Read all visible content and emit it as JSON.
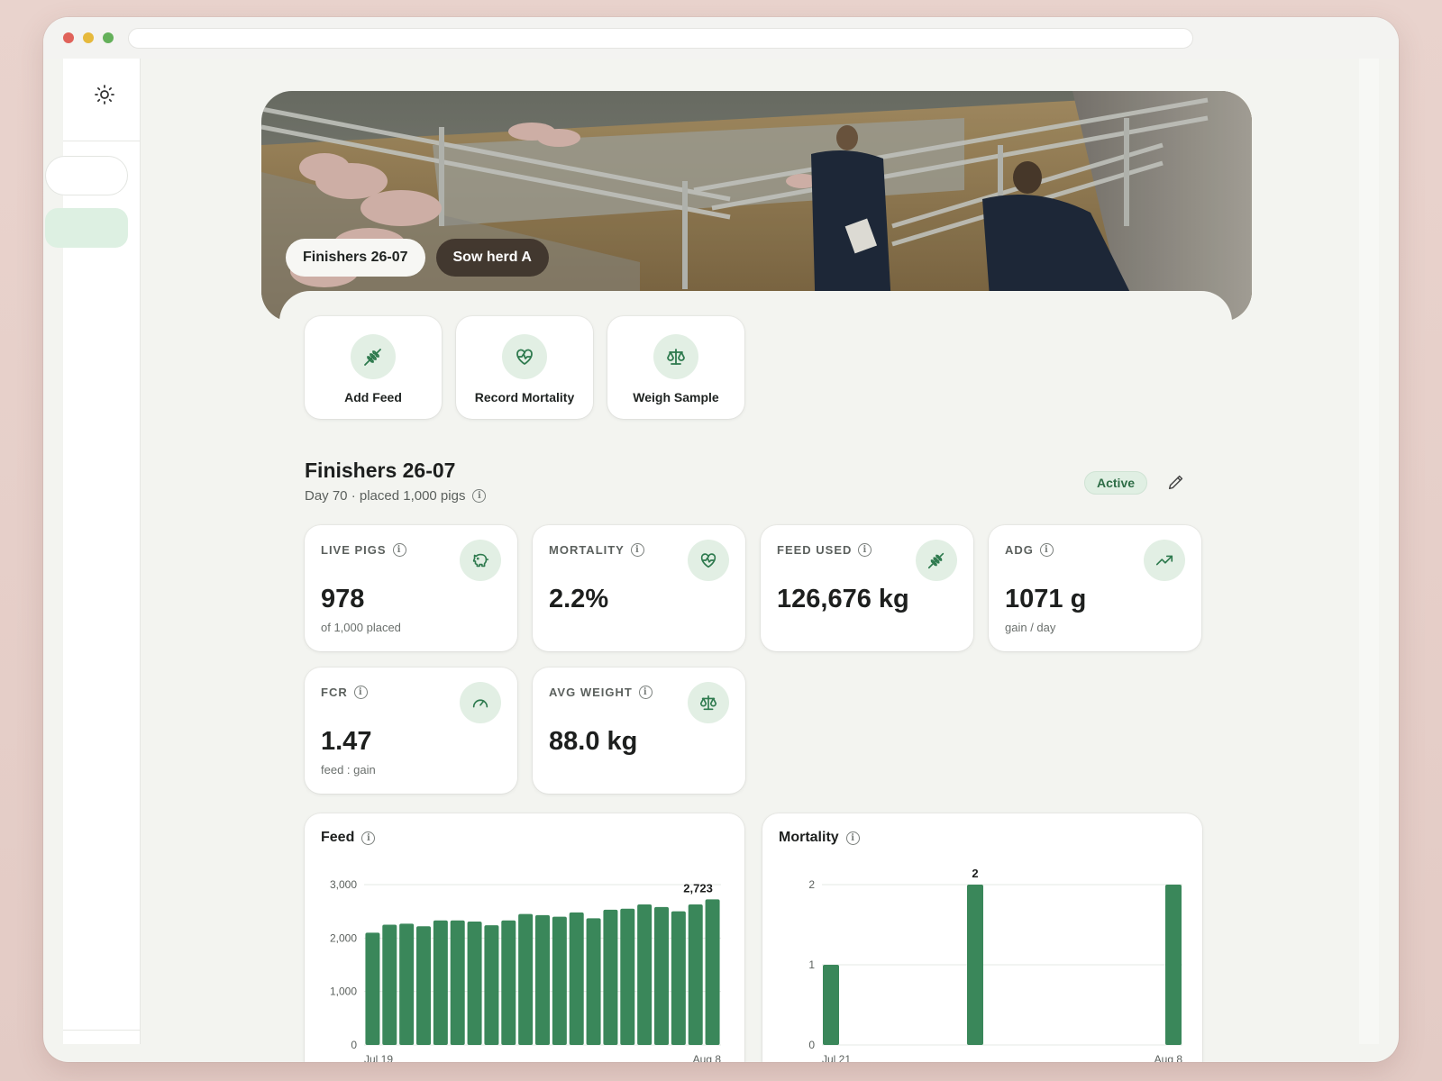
{
  "hero": {
    "chips": [
      {
        "label": "Finishers 26-07",
        "active": true
      },
      {
        "label": "Sow herd A",
        "active": false
      }
    ]
  },
  "actions": [
    {
      "label": "Add Feed",
      "icon": "wheat-icon"
    },
    {
      "label": "Record Mortality",
      "icon": "heart-pulse-icon"
    },
    {
      "label": "Weigh Sample",
      "icon": "scale-icon"
    }
  ],
  "batch": {
    "title": "Finishers 26-07",
    "subtitle": "Day 70 · placed 1,000 pigs",
    "status": "Active"
  },
  "stats": [
    {
      "label": "LIVE PIGS",
      "value": "978",
      "sub": "of 1,000 placed",
      "icon": "pig-icon"
    },
    {
      "label": "MORTALITY",
      "value": "2.2%",
      "sub": "",
      "icon": "heart-pulse-icon"
    },
    {
      "label": "FEED USED",
      "value": "126,676 kg",
      "sub": "",
      "icon": "wheat-icon"
    },
    {
      "label": "ADG",
      "value": "1071 g",
      "sub": "gain / day",
      "icon": "trend-up-icon"
    },
    {
      "label": "FCR",
      "value": "1.47",
      "sub": "feed : gain",
      "icon": "gauge-icon"
    },
    {
      "label": "AVG WEIGHT",
      "value": "88.0 kg",
      "sub": "",
      "icon": "scale-icon"
    }
  ],
  "colors": {
    "accent": "#2e7a4e",
    "bar": "#3a875a",
    "iconBg": "#e2efe4"
  },
  "chart_data": [
    {
      "type": "bar",
      "title": "Feed",
      "x_start_label": "Jul 19",
      "x_end_label": "Aug 8",
      "yticks": [
        "0",
        "1,000",
        "2,000",
        "3,000"
      ],
      "ylim": [
        0,
        3000
      ],
      "values": [
        2100,
        2250,
        2270,
        2220,
        2330,
        2330,
        2310,
        2240,
        2330,
        2450,
        2430,
        2400,
        2480,
        2370,
        2530,
        2550,
        2630,
        2580,
        2500,
        2630,
        2723
      ],
      "peak_label": "2,723",
      "grid": true
    },
    {
      "type": "bar",
      "title": "Mortality",
      "x_start_label": "Jul 21",
      "x_end_label": "Aug 8",
      "yticks": [
        "0",
        "1",
        "2"
      ],
      "ylim": [
        0,
        2
      ],
      "values": [
        1,
        0,
        0,
        0,
        0,
        0,
        0,
        0,
        2,
        0,
        0,
        0,
        0,
        0,
        0,
        0,
        0,
        0,
        0,
        2
      ],
      "peak_label": "2",
      "peak_index": 8,
      "grid": true
    }
  ]
}
